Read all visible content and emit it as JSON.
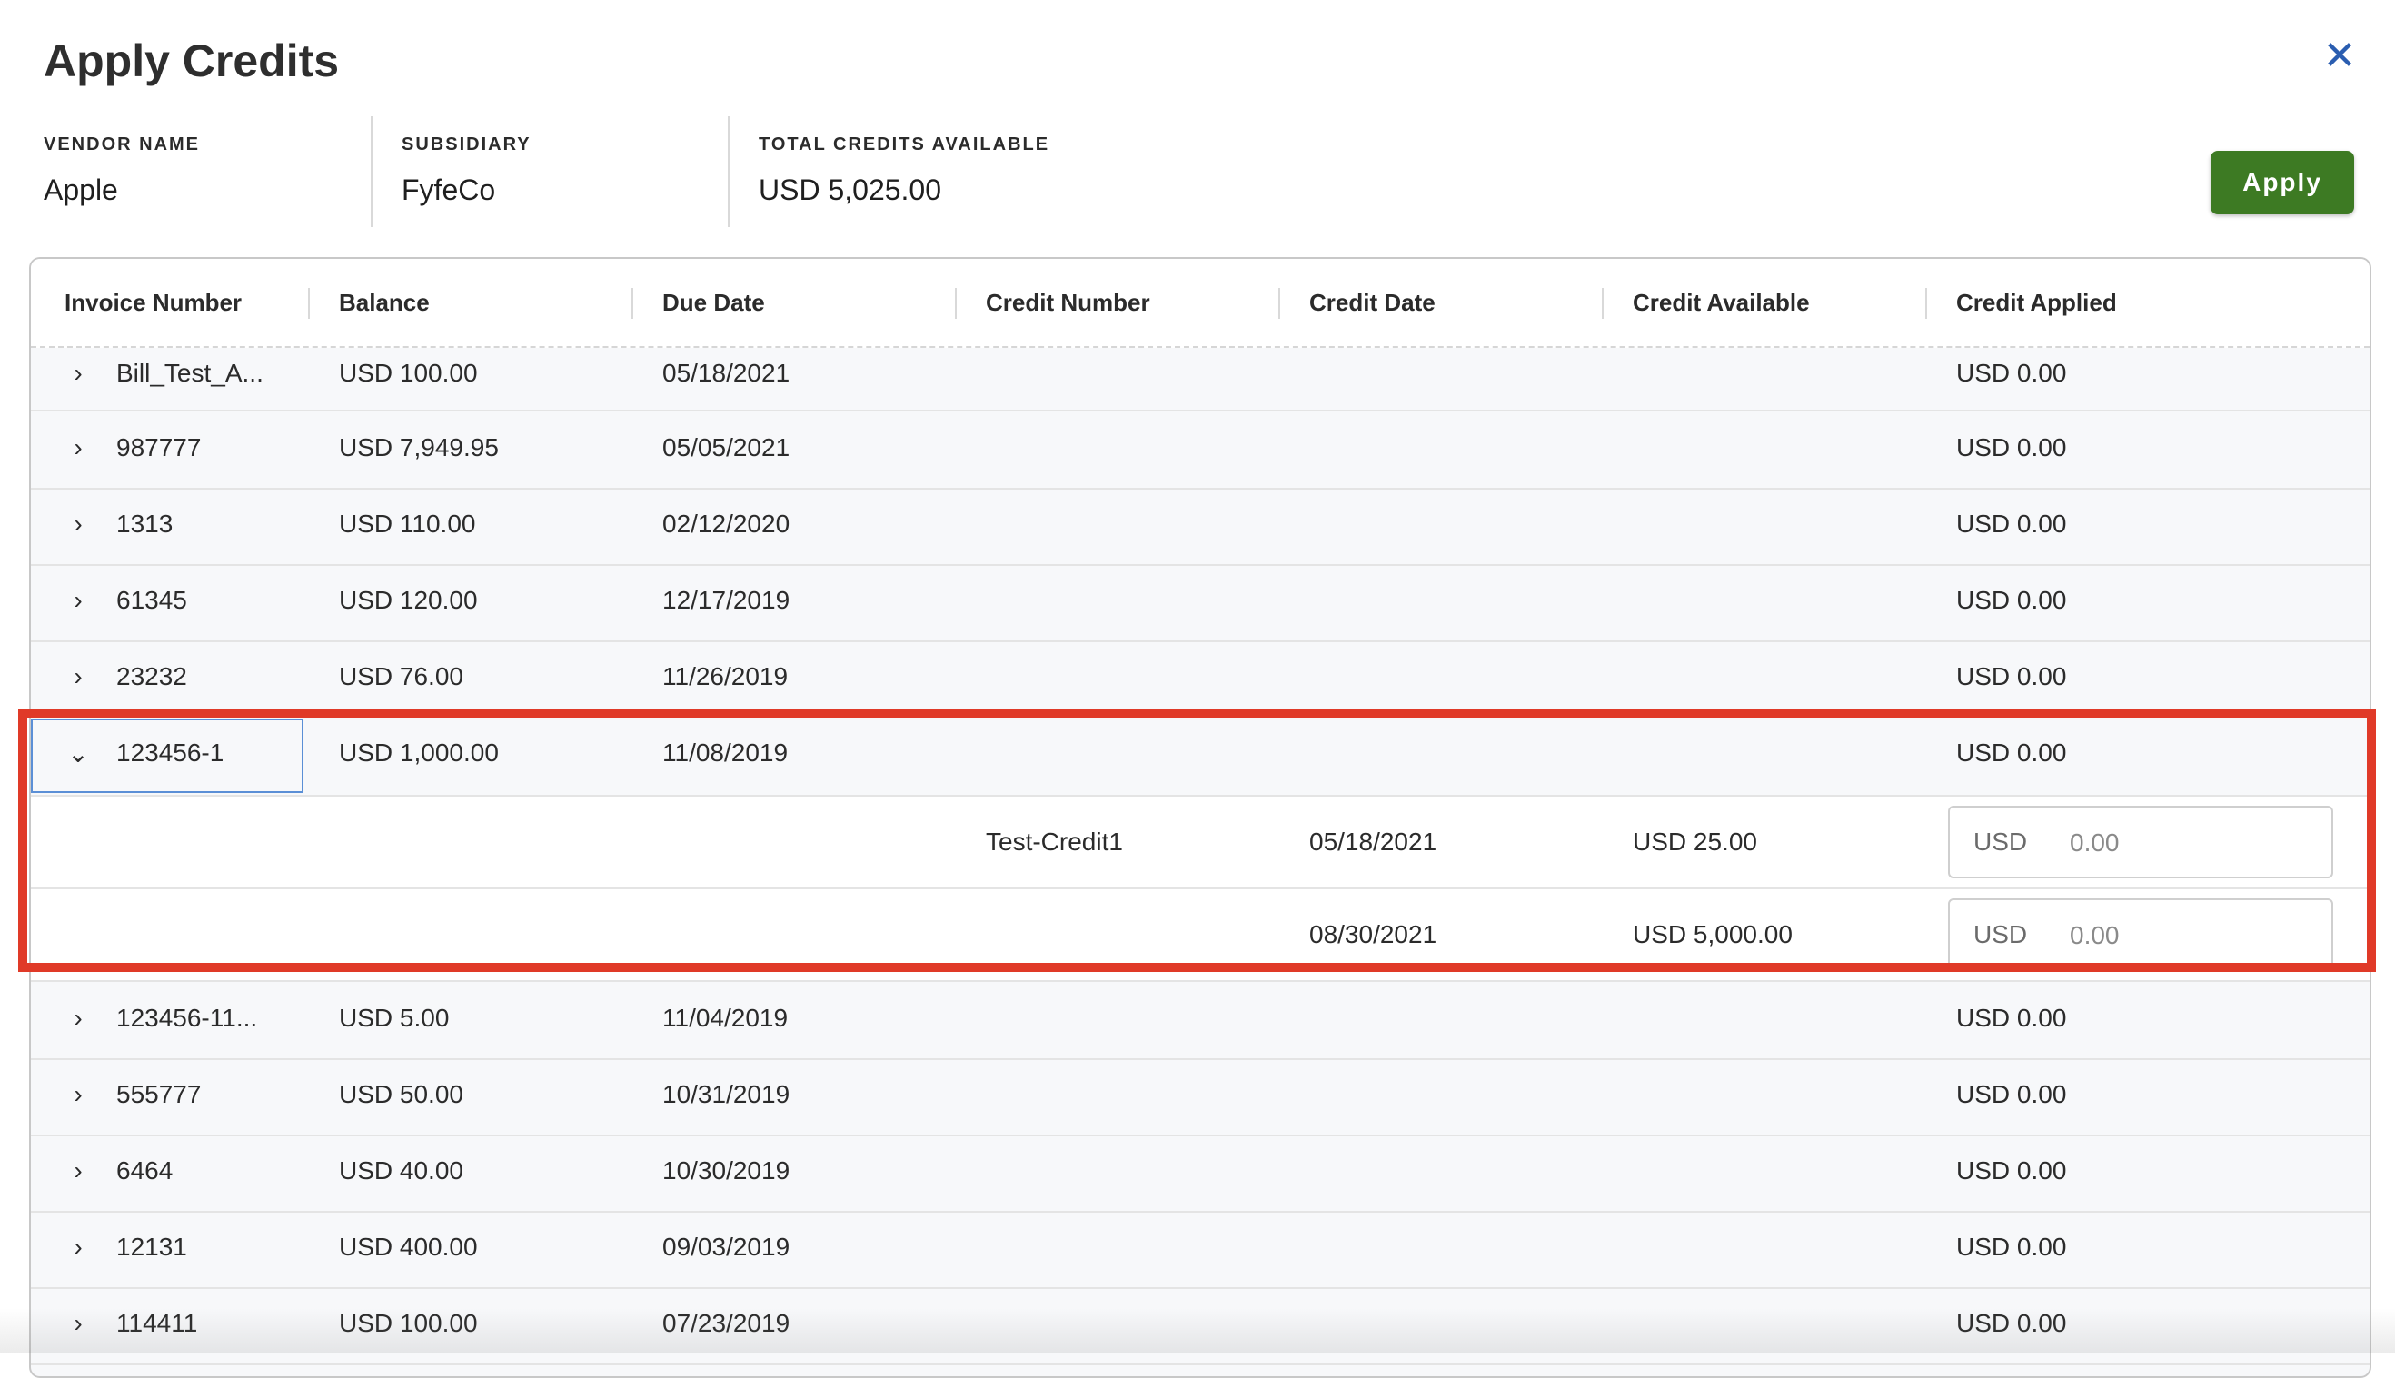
{
  "dialog": {
    "title": "Apply Credits",
    "close_icon": "close-icon",
    "apply_label": "Apply",
    "accent": "#3d7a23"
  },
  "meta": {
    "vendor_label": "VENDOR NAME",
    "vendor_value": "Apple",
    "subsidiary_label": "SUBSIDIARY",
    "subsidiary_value": "FyfeCo",
    "credits_label": "TOTAL CREDITS AVAILABLE",
    "credits_value": "USD 5,025.00"
  },
  "table": {
    "columns": [
      "Invoice Number",
      "Balance",
      "Due Date",
      "Credit Number",
      "Credit Date",
      "Credit Available",
      "Credit Applied"
    ],
    "rows_before": [
      {
        "invoice": "Bill_Test_A...",
        "balance": "USD 100.00",
        "due": "05/18/2021",
        "applied": "USD 0.00"
      },
      {
        "invoice": "987777",
        "balance": "USD 7,949.95",
        "due": "05/05/2021",
        "applied": "USD 0.00"
      },
      {
        "invoice": "1313",
        "balance": "USD 110.00",
        "due": "02/12/2020",
        "applied": "USD 0.00"
      },
      {
        "invoice": "61345",
        "balance": "USD 120.00",
        "due": "12/17/2019",
        "applied": "USD 0.00"
      },
      {
        "invoice": "23232",
        "balance": "USD 76.00",
        "due": "11/26/2019",
        "applied": "USD 0.00"
      }
    ],
    "expanded": {
      "invoice": "123456-1",
      "balance": "USD 1,000.00",
      "due": "11/08/2019",
      "applied": "USD 0.00",
      "credits": [
        {
          "credit_number": "Test-Credit1",
          "credit_date": "05/18/2021",
          "available": "USD 25.00",
          "currency": "USD",
          "placeholder": "0.00"
        },
        {
          "credit_number": "",
          "credit_date": "08/30/2021",
          "available": "USD 5,000.00",
          "currency": "USD",
          "placeholder": "0.00"
        }
      ]
    },
    "rows_after": [
      {
        "invoice": "123456-11...",
        "balance": "USD 5.00",
        "due": "11/04/2019",
        "applied": "USD 0.00"
      },
      {
        "invoice": "555777",
        "balance": "USD 50.00",
        "due": "10/31/2019",
        "applied": "USD 0.00"
      },
      {
        "invoice": "6464",
        "balance": "USD 40.00",
        "due": "10/30/2019",
        "applied": "USD 0.00"
      },
      {
        "invoice": "12131",
        "balance": "USD 400.00",
        "due": "09/03/2019",
        "applied": "USD 0.00"
      },
      {
        "invoice": "114411",
        "balance": "USD 100.00",
        "due": "07/23/2019",
        "applied": "USD 0.00"
      }
    ]
  },
  "highlight_color": "#e03a28"
}
